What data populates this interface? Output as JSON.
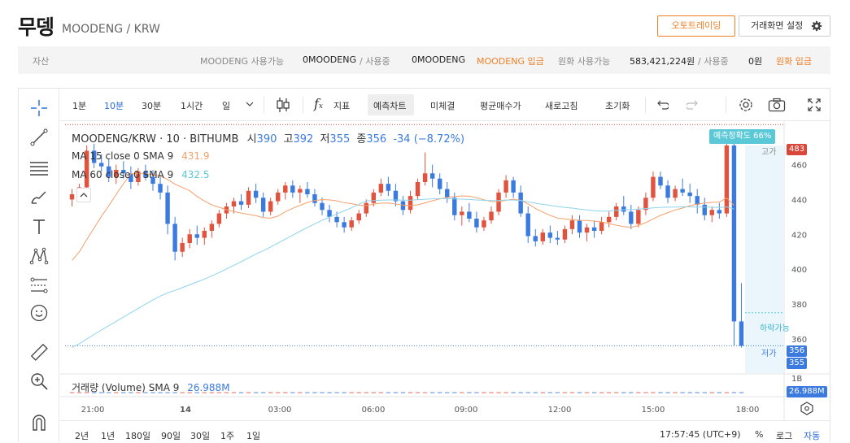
{
  "header": {
    "coin_name": "무뎅",
    "pair": "MOODENG / KRW",
    "auto_trading": "오토트레이딩",
    "screen_setting": "거래화면 설정"
  },
  "asset_bar": {
    "label": "자산",
    "coin_available_label": "MOODENG 사용가능",
    "coin_available": "0MOODENG",
    "slash_in_use": "/ 사용중",
    "coin_in_use": "0MOODENG",
    "coin_deposit": "MOODENG 입금",
    "krw_available_label": "원화 사용가능",
    "krw_available": "583,421,224원",
    "krw_slash_in_use": "/ 사용중",
    "krw_in_use": "0원",
    "krw_deposit": "원화 입금"
  },
  "toolbar": {
    "intervals": [
      "1분",
      "10분",
      "30분",
      "1시간",
      "일"
    ],
    "active_interval": "10분",
    "indicator": "지표",
    "forecast_chart": "예측차트",
    "micro_settle": "미체결",
    "avg_buy": "평균매수가",
    "refresh": "새로고침",
    "reset": "초기화"
  },
  "legend": {
    "symbol": "MOODENG/KRW · 10 · BITHUMB",
    "open_label": "시",
    "open": "390",
    "high_label": "고",
    "high": "392",
    "low_label": "저",
    "low": "355",
    "close_label": "종",
    "close": "356",
    "change": "-34 (−8.72%)",
    "ma15_label": "MA 15 close 0 SMA 9",
    "ma15_value": "431.9",
    "ma60_label": "MA 60 close 0 SMA 9",
    "ma60_value": "432.5",
    "volume_label": "거래량 (Volume) SMA 9",
    "volume_value": "26.988M"
  },
  "price_axis": {
    "ticks": [
      "460",
      "440",
      "420",
      "400",
      "380",
      "360"
    ],
    "tag_high_price": "483",
    "tag_current": "356",
    "tag_low": "355",
    "volume_tick": "1B",
    "volume_tag": "26.988M"
  },
  "chips": {
    "forecast_accuracy": "예측정확도 66%",
    "high_label": "고가",
    "low_label": "저가",
    "possible_drop": "하락가능"
  },
  "time_axis": [
    "21:00",
    "14",
    "03:00",
    "06:00",
    "09:00",
    "12:00",
    "15:00",
    "18:00"
  ],
  "bottom_bar": {
    "ranges": [
      "2년",
      "1년",
      "180일",
      "90일",
      "30일",
      "1주",
      "1일"
    ],
    "clock": "17:57:45 (UTC+9)",
    "percent": "%",
    "log": "로그",
    "auto": "자동"
  },
  "colors": {
    "up": "#e0533f",
    "down": "#3b7be0",
    "ma15": "#f5a06a",
    "ma60": "#8fd3ec",
    "accent": "#f07f26",
    "active": "#2a6bd8",
    "forecast": "#5ac8d6"
  },
  "chart_data": {
    "type": "candlestick",
    "ylim": [
      345,
      485
    ],
    "candles": [
      [
        440,
        446,
        436,
        443
      ],
      [
        443,
        449,
        440,
        447
      ],
      [
        447,
        471,
        444,
        468
      ],
      [
        468,
        472,
        458,
        461
      ],
      [
        461,
        466,
        456,
        459
      ],
      [
        459,
        463,
        450,
        453
      ],
      [
        453,
        460,
        449,
        457
      ],
      [
        457,
        462,
        452,
        455
      ],
      [
        455,
        459,
        446,
        450
      ],
      [
        450,
        458,
        448,
        456
      ],
      [
        456,
        460,
        451,
        453
      ],
      [
        453,
        457,
        445,
        449
      ],
      [
        449,
        453,
        440,
        444
      ],
      [
        444,
        448,
        420,
        426
      ],
      [
        426,
        430,
        405,
        410
      ],
      [
        410,
        418,
        407,
        415
      ],
      [
        415,
        423,
        412,
        420
      ],
      [
        420,
        425,
        414,
        418
      ],
      [
        418,
        424,
        414,
        422
      ],
      [
        422,
        428,
        418,
        426
      ],
      [
        426,
        434,
        424,
        432
      ],
      [
        432,
        438,
        429,
        436
      ],
      [
        436,
        441,
        432,
        439
      ],
      [
        439,
        443,
        434,
        437
      ],
      [
        437,
        447,
        435,
        445
      ],
      [
        445,
        449,
        438,
        441
      ],
      [
        441,
        444,
        430,
        433
      ],
      [
        433,
        441,
        431,
        439
      ],
      [
        439,
        446,
        437,
        444
      ],
      [
        444,
        450,
        440,
        448
      ],
      [
        448,
        451,
        441,
        444
      ],
      [
        444,
        448,
        438,
        446
      ],
      [
        446,
        450,
        441,
        443
      ],
      [
        443,
        446,
        436,
        438
      ],
      [
        438,
        441,
        431,
        434
      ],
      [
        434,
        437,
        427,
        430
      ],
      [
        430,
        433,
        424,
        427
      ],
      [
        427,
        430,
        421,
        424
      ],
      [
        424,
        430,
        422,
        428
      ],
      [
        428,
        434,
        426,
        432
      ],
      [
        432,
        440,
        430,
        438
      ],
      [
        438,
        446,
        436,
        444
      ],
      [
        444,
        452,
        442,
        449
      ],
      [
        449,
        453,
        442,
        445
      ],
      [
        445,
        449,
        436,
        439
      ],
      [
        439,
        442,
        431,
        434
      ],
      [
        434,
        445,
        432,
        442
      ],
      [
        442,
        452,
        440,
        450
      ],
      [
        450,
        467,
        448,
        455
      ],
      [
        455,
        460,
        447,
        452
      ],
      [
        452,
        455,
        443,
        446
      ],
      [
        446,
        450,
        438,
        441
      ],
      [
        441,
        444,
        428,
        431
      ],
      [
        431,
        436,
        425,
        433
      ],
      [
        433,
        438,
        427,
        429
      ],
      [
        429,
        433,
        421,
        424
      ],
      [
        424,
        430,
        422,
        428
      ],
      [
        428,
        436,
        426,
        433
      ],
      [
        433,
        446,
        431,
        444
      ],
      [
        444,
        454,
        441,
        451
      ],
      [
        451,
        453,
        441,
        444
      ],
      [
        444,
        448,
        430,
        432
      ],
      [
        432,
        436,
        415,
        419
      ],
      [
        419,
        423,
        413,
        416
      ],
      [
        416,
        423,
        414,
        421
      ],
      [
        421,
        425,
        415,
        418
      ],
      [
        418,
        422,
        414,
        417
      ],
      [
        417,
        425,
        415,
        423
      ],
      [
        423,
        431,
        420,
        428
      ],
      [
        428,
        431,
        418,
        421
      ],
      [
        421,
        426,
        416,
        424
      ],
      [
        424,
        428,
        418,
        422
      ],
      [
        422,
        430,
        420,
        427
      ],
      [
        427,
        433,
        424,
        430
      ],
      [
        430,
        438,
        428,
        436
      ],
      [
        436,
        442,
        431,
        433
      ],
      [
        433,
        437,
        423,
        426
      ],
      [
        426,
        436,
        424,
        434
      ],
      [
        434,
        444,
        431,
        441
      ],
      [
        441,
        456,
        439,
        453
      ],
      [
        453,
        456,
        446,
        448
      ],
      [
        448,
        451,
        438,
        441
      ],
      [
        441,
        448,
        439,
        446
      ],
      [
        446,
        452,
        442,
        444
      ],
      [
        444,
        449,
        438,
        442
      ],
      [
        442,
        446,
        432,
        437
      ],
      [
        437,
        441,
        428,
        431
      ],
      [
        431,
        436,
        427,
        434
      ],
      [
        434,
        438,
        429,
        432
      ],
      [
        432,
        479,
        430,
        471
      ],
      [
        471,
        474,
        356,
        370
      ],
      [
        370,
        392,
        355,
        356
      ]
    ],
    "ma15_note": "MA 15 close 0 SMA 9",
    "ma60_note": "MA 60 close 0 SMA 9"
  }
}
